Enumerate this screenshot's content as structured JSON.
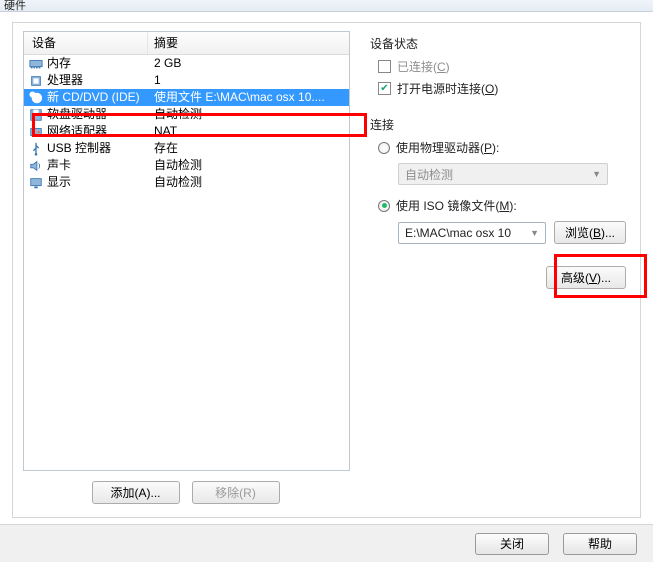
{
  "title": "硬件",
  "hw_header": {
    "device": "设备",
    "summary": "摘要"
  },
  "hw": [
    {
      "icon": "memory",
      "name": "内存",
      "summary": "2 GB"
    },
    {
      "icon": "cpu",
      "name": "处理器",
      "summary": "1"
    },
    {
      "icon": "cd-new",
      "name": "新 CD/DVD (IDE)",
      "summary": "使用文件 E:\\MAC\\mac osx 10...."
    },
    {
      "icon": "floppy",
      "name": "软盘驱动器",
      "summary": "自动检测"
    },
    {
      "icon": "nic",
      "name": "网络适配器",
      "summary": "NAT"
    },
    {
      "icon": "usb",
      "name": "USB 控制器",
      "summary": "存在"
    },
    {
      "icon": "sound",
      "name": "声卡",
      "summary": "自动检测"
    },
    {
      "icon": "display",
      "name": "显示",
      "summary": "自动检测"
    }
  ],
  "btn_add": "添加(A)...",
  "btn_remove": "移除(R)",
  "sec_status": "设备状态",
  "chk_connected": {
    "pre": "已连接(",
    "u": "C",
    "post": ")"
  },
  "chk_power": {
    "pre": "打开电源时连接(",
    "u": "O",
    "post": ")"
  },
  "sec_conn": "连接",
  "radio_phys": {
    "pre": "使用物理驱动器(",
    "u": "P",
    "post": "):"
  },
  "phys_value": "自动检测",
  "radio_iso": {
    "pre": "使用 ISO 镜像文件(",
    "u": "M",
    "post": "):"
  },
  "iso_value": "E:\\MAC\\mac osx 10",
  "btn_browse": {
    "pre": "浏览(",
    "u": "B",
    "post": ")..."
  },
  "btn_adv": {
    "pre": "高级(",
    "u": "V",
    "post": ")..."
  },
  "btn_close": "关闭",
  "btn_help": "帮助"
}
